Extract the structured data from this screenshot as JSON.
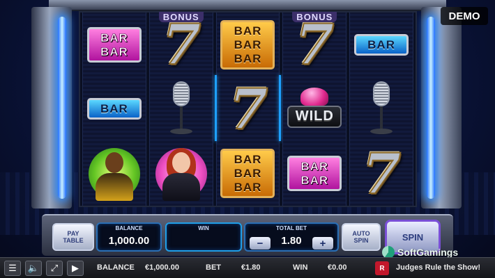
{
  "badge": {
    "demo": "DEMO"
  },
  "reels": [
    [
      {
        "type": "bar",
        "color": "pink",
        "lines": [
          "BAR",
          "BAR"
        ]
      },
      {
        "type": "bar",
        "color": "blue",
        "lines": [
          "BAR"
        ]
      },
      {
        "type": "character",
        "who": "man"
      }
    ],
    [
      {
        "type": "seven",
        "tag": "BONUS"
      },
      {
        "type": "mic"
      },
      {
        "type": "character",
        "who": "woman"
      }
    ],
    [
      {
        "type": "bar",
        "color": "gold",
        "lines": [
          "BAR",
          "BAR",
          "BAR"
        ]
      },
      {
        "type": "seven"
      },
      {
        "type": "bar",
        "color": "gold",
        "lines": [
          "BAR",
          "BAR",
          "BAR"
        ]
      }
    ],
    [
      {
        "type": "seven",
        "tag": "BONUS"
      },
      {
        "type": "wild",
        "label": "WILD"
      },
      {
        "type": "bar",
        "color": "pink",
        "lines": [
          "BAR",
          "BAR"
        ]
      }
    ],
    [
      {
        "type": "bar",
        "color": "blue",
        "lines": [
          "BAR"
        ]
      },
      {
        "type": "mic"
      },
      {
        "type": "seven"
      }
    ]
  ],
  "colors": {
    "pink": "#e040c8",
    "gold": "#f2a51c",
    "blue": "#1c9ae8",
    "accent": "#1f9fe8"
  },
  "console": {
    "pay_table": [
      "PAY",
      "TABLE"
    ],
    "balance_label": "BALANCE",
    "balance_value": "1,000.00",
    "win_label": "WIN",
    "win_value": "",
    "total_bet_label": "TOTAL BET",
    "total_bet_value": "1.80",
    "minus": "−",
    "plus": "+",
    "auto_spin": [
      "AUTO",
      "SPIN"
    ],
    "spin": "SPIN"
  },
  "statusbar": {
    "icons": [
      "menu-icon",
      "sound-icon",
      "fullscreen-icon",
      "video-icon"
    ],
    "balance_label": "BALANCE",
    "balance_value": "€1,000.00",
    "bet_label": "BET",
    "bet_value": "€1.80",
    "win_label": "WIN",
    "win_value": "€0.00",
    "provider_logo": "R",
    "game_title": "Judges Rule the Show!"
  },
  "watermark": "SoftGamings"
}
